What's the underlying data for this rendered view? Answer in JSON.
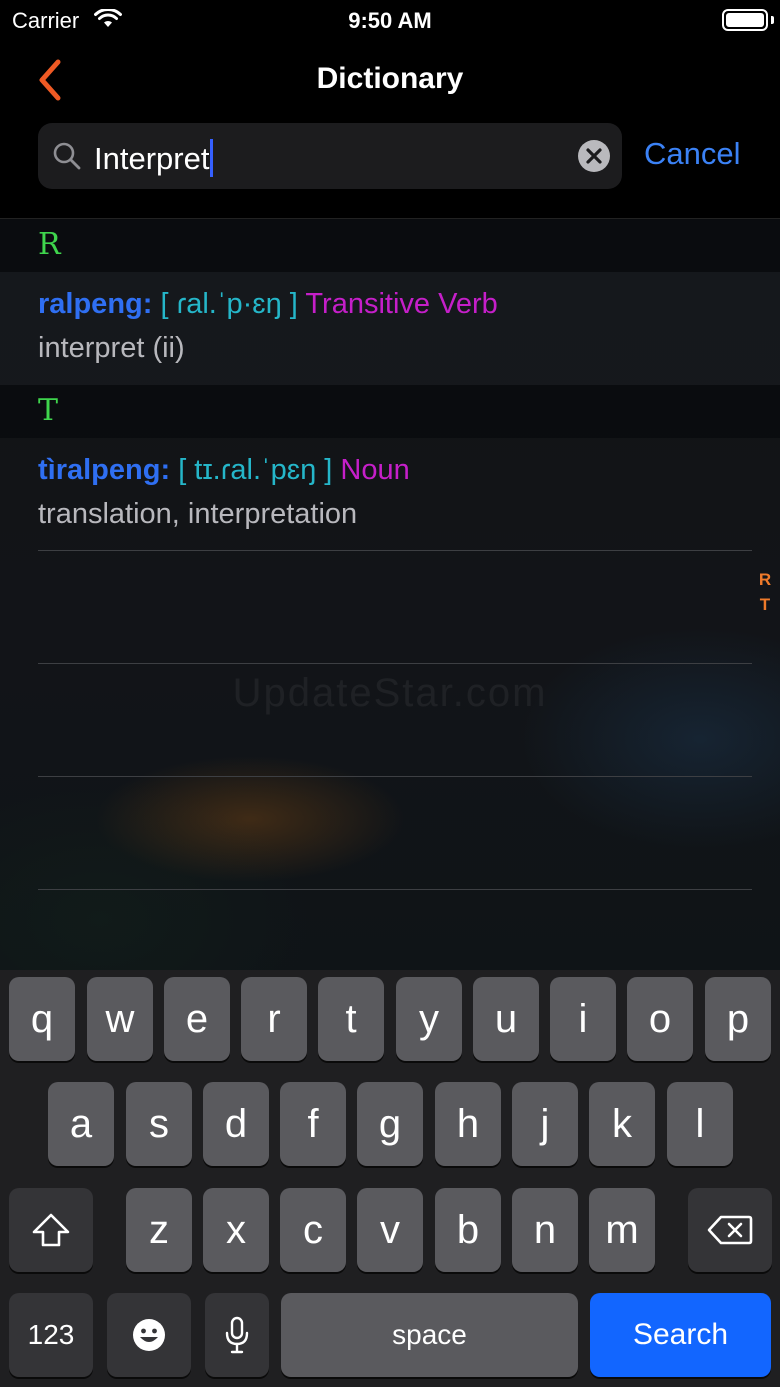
{
  "status_bar": {
    "carrier": "Carrier",
    "time": "9:50 AM"
  },
  "nav": {
    "title": "Dictionary"
  },
  "search": {
    "query": "Interpret",
    "cancel_label": "Cancel"
  },
  "sections": [
    {
      "letter": "R",
      "entries": [
        {
          "word": "ralpeng:",
          "ipa": "[ ɾal.ˈp·ɛŋ ]",
          "pos": "Transitive Verb",
          "definition": "interpret (ii)"
        }
      ]
    },
    {
      "letter": "T",
      "entries": [
        {
          "word": "tìralpeng:",
          "ipa": "[ tɪ.ɾal.ˈpɛŋ ]",
          "pos": "Noun",
          "definition": "translation, interpretation"
        }
      ]
    }
  ],
  "section_index": [
    "R",
    "T"
  ],
  "watermark": "UpdateStar.com",
  "keyboard": {
    "row1": [
      "q",
      "w",
      "e",
      "r",
      "t",
      "y",
      "u",
      "i",
      "o",
      "p"
    ],
    "row2": [
      "a",
      "s",
      "d",
      "f",
      "g",
      "h",
      "j",
      "k",
      "l"
    ],
    "row3": [
      "z",
      "x",
      "c",
      "v",
      "b",
      "n",
      "m"
    ],
    "numbers_label": "123",
    "space_label": "space",
    "search_label": "Search"
  },
  "colors": {
    "accent": "#ef5a24",
    "link": "#3b82f6",
    "section_letter": "#3fd54d",
    "word": "#2f6ff2",
    "ipa": "#25b6c9",
    "pos": "#c51fc9",
    "search_key": "#1266ff"
  }
}
